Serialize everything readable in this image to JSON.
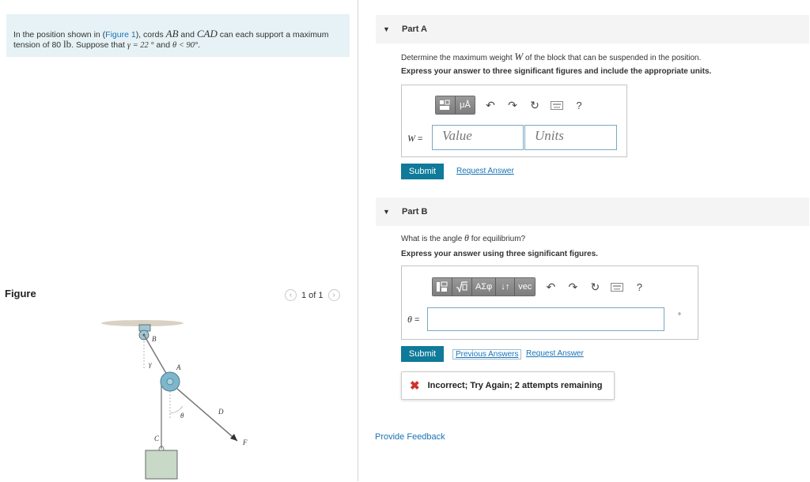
{
  "problem": {
    "t1": "In the position shown in (",
    "figure_link": "Figure 1",
    "t2": "), cords ",
    "ab": "AB",
    "t3": " and ",
    "cad": "CAD",
    "t4": " can each support a maximum",
    "line2a": "tension of 80 ",
    "lb": "lb",
    "line2b": ". Suppose that ",
    "gamma_expr": "γ = 22 °",
    "and": " and ",
    "theta_expr": "θ < 90°",
    "end": "."
  },
  "figure": {
    "title": "Figure",
    "pager": "1 of 1",
    "labels": {
      "B": "B",
      "A": "A",
      "gamma": "γ",
      "theta": "θ",
      "D": "D",
      "C": "C",
      "F": "F"
    }
  },
  "partA": {
    "title": "Part A",
    "q1a": "Determine the maximum weight ",
    "q1var": "W",
    "q1b": " of the block that can be suspended in the position.",
    "instruction": "Express your answer to three significant figures and include the appropriate units.",
    "toolbar": {
      "units_btn": "μÅ",
      "help": "?"
    },
    "var_label": "W",
    "eq": " =",
    "value_placeholder": "Value",
    "units_placeholder": "Units",
    "submit": "Submit",
    "request": "Request Answer"
  },
  "partB": {
    "title": "Part B",
    "q1a": "What is the angle ",
    "q1var": "θ",
    "q1b": " for equilibrium?",
    "instruction": "Express your answer using three significant figures.",
    "toolbar": {
      "greek": "ΑΣφ",
      "arrows": "↓↑",
      "vec": "vec",
      "help": "?"
    },
    "var_label": "θ",
    "eq": " =",
    "unit": "°",
    "submit": "Submit",
    "previous": "Previous Answers",
    "request": "Request Answer",
    "feedback": "Incorrect; Try Again; 2 attempts remaining"
  },
  "provide_feedback": "Provide Feedback",
  "colors": {
    "accent": "#0f7a99",
    "link": "#1a73b5",
    "error": "#d0312d",
    "problem_bg": "#e6f2f5"
  }
}
